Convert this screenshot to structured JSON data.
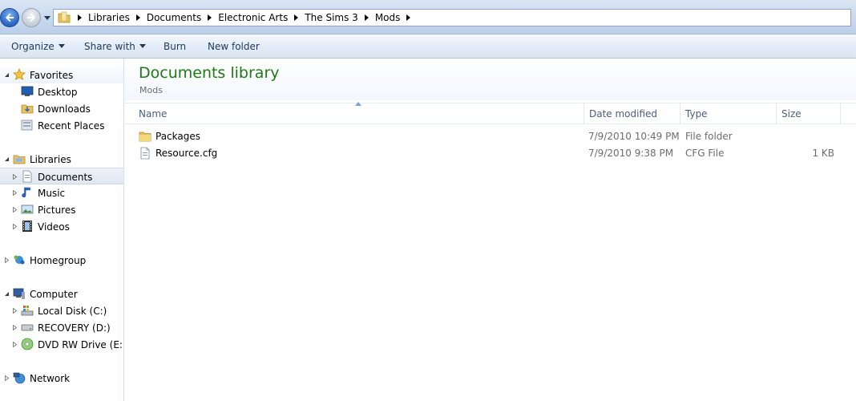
{
  "address": {
    "crumbs": [
      "Libraries",
      "Documents",
      "Electronic Arts",
      "The Sims 3",
      "Mods"
    ]
  },
  "toolbar": {
    "organize": "Organize",
    "share_with": "Share with",
    "burn": "Burn",
    "new_folder": "New folder"
  },
  "nav": {
    "favorites": "Favorites",
    "desktop": "Desktop",
    "downloads": "Downloads",
    "recent_places": "Recent Places",
    "libraries": "Libraries",
    "documents": "Documents",
    "music": "Music",
    "pictures": "Pictures",
    "videos": "Videos",
    "homegroup": "Homegroup",
    "computer": "Computer",
    "local_disk": "Local Disk (C:)",
    "recovery": "RECOVERY (D:)",
    "dvd_drive": "DVD RW Drive (E:) Si",
    "network": "Network"
  },
  "library": {
    "title": "Documents library",
    "subtitle": "Mods"
  },
  "columns": {
    "name": "Name",
    "date_modified": "Date modified",
    "type": "Type",
    "size": "Size"
  },
  "files": [
    {
      "name": "Packages",
      "date": "7/9/2010 10:49 PM",
      "type": "File folder",
      "size": "",
      "icon": "folder-icon"
    },
    {
      "name": "Resource.cfg",
      "date": "7/9/2010 9:38 PM",
      "type": "CFG File",
      "size": "1 KB",
      "icon": "cfg-file-icon"
    }
  ],
  "colors": {
    "title_green": "#1e7a16",
    "header_text": "#4c607a",
    "accent_blue": "#2a63c4"
  }
}
